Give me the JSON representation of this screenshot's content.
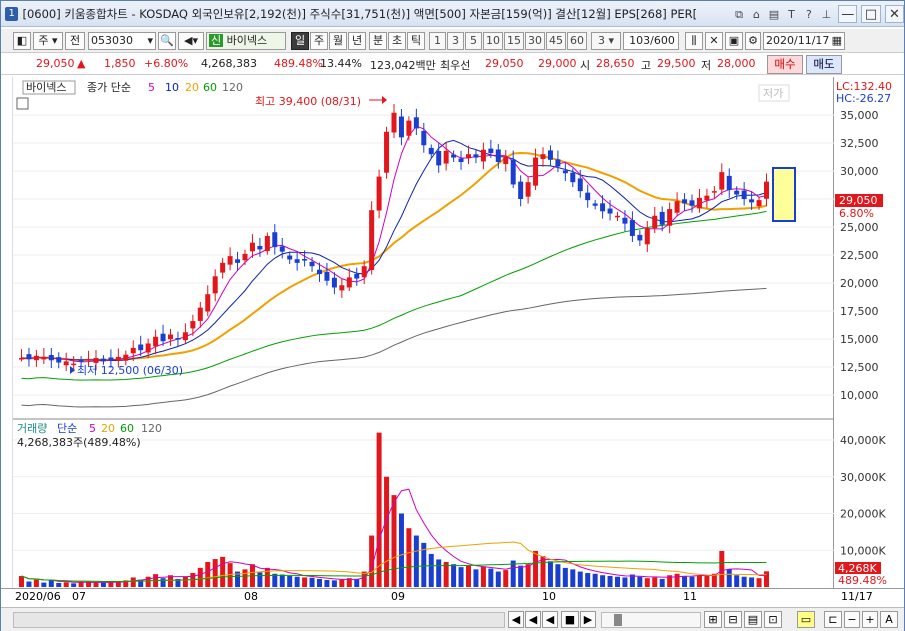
{
  "titlebar": {
    "number": "1",
    "title": "[0600] 키움종합차트 - KOSDAQ 외국인보유[2,192(천)] 주식수[31,751(천)] 액면[500] 자본금[159(억)] 결산[12월] EPS[268] PER[",
    "icons": [
      "copy-icon",
      "link-icon",
      "list-icon",
      "text-icon",
      "help-icon",
      "pin-icon"
    ],
    "minimize": "—",
    "maximize": "□",
    "close": "✕"
  },
  "toolbar": {
    "chart_type": "주",
    "prev": "전",
    "code": "053030",
    "stock_name_badge": "신",
    "stock_name": "바이넥스",
    "periods": [
      "일",
      "주",
      "월",
      "년",
      "분",
      "초",
      "틱"
    ],
    "selected_period": "일",
    "intervals": [
      "1",
      "3",
      "5",
      "10",
      "15",
      "30",
      "45",
      "60"
    ],
    "interval_value": "3",
    "count": "103/600",
    "date": "2020/11/17"
  },
  "infobar": {
    "price": "29,050",
    "change_arrow": "▲",
    "change": "1,850",
    "change_pct": "+6.80%",
    "volume": "4,268,383",
    "volume_pct": "489.48%",
    "turnover": "13.44%",
    "amount": "123,042백만",
    "best_ask_label": "최우선",
    "best_ask": "29,050",
    "best_bid": "29,000",
    "open_label": "시",
    "open": "28,650",
    "high_label": "고",
    "high": "29,500",
    "low_label": "저",
    "low": "28,000",
    "buy": "매수",
    "sell": "매도"
  },
  "chart": {
    "stock_label": "바이넥스",
    "price_legend": {
      "title": "종가 단순",
      "ma": [
        "5",
        "10",
        "20",
        "60",
        "120"
      ]
    },
    "ma_colors": [
      "#d000c0",
      "#1022a8",
      "#f0a000",
      "#00a000",
      "#666666"
    ],
    "high_note": "최고 39,400 (08/31)",
    "low_note": "최저 12,500 (06/30)",
    "corner_label": "저가",
    "lc": "LC:132.40",
    "hc": "HC:-26.27",
    "price_ticks": [
      "35,000",
      "32,500",
      "30,000",
      "27,500",
      "25,000",
      "22,500",
      "20,000",
      "17,500",
      "15,000",
      "12,500",
      "10,000"
    ],
    "current_price_tag": "29,050",
    "current_pct_tag": "6.80%",
    "volume_legend": {
      "title": "거래량",
      "sub": "단순",
      "ma": [
        "5",
        "20",
        "60",
        "120"
      ]
    },
    "volume_value": "4,268,383주(489.48%)",
    "volume_ticks": [
      "40,000K",
      "30,000K",
      "20,000K",
      "10,000K"
    ],
    "current_volume_tag": "4,268K",
    "current_volume_pct_tag": "489.48%",
    "up_color": "#e2161b",
    "down_color": "#1a3fd0"
  },
  "timeline": {
    "labels": [
      "2020/06",
      "07",
      "08",
      "09",
      "10",
      "11"
    ],
    "end_label": "11/17"
  },
  "bottombar": {
    "zoom_in": "+",
    "zoom_out": "−",
    "font_label": "A"
  }
}
